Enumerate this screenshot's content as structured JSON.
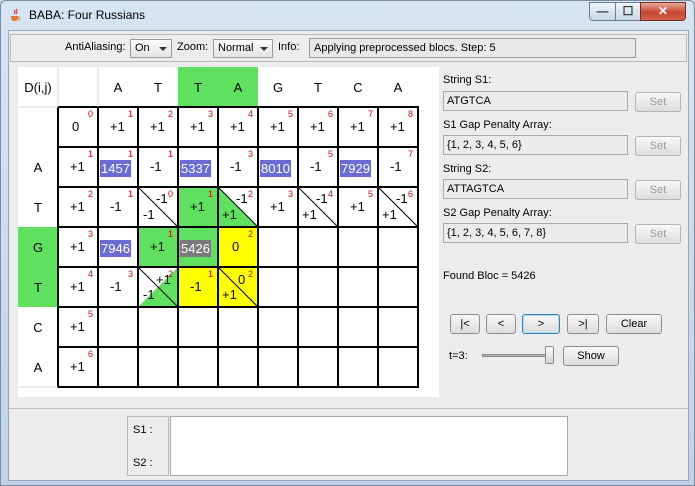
{
  "window": {
    "title": "BABA: Four Russians",
    "min_glyph": "—",
    "max_glyph": "☐",
    "close_glyph": "✕"
  },
  "toolbar": {
    "antialiasing_label": "AntiAliasing:",
    "antialiasing_value": "On",
    "zoom_label": "Zoom:",
    "zoom_value": "Normal",
    "info_label": "Info:",
    "info_text": "Applying preprocessed blocs. Step: 5"
  },
  "grid": {
    "corner_label": "D(i,j)",
    "col_headers": [
      "A",
      "T",
      "T",
      "A",
      "G",
      "T",
      "C",
      "A"
    ],
    "row_headers": [
      "A",
      "T",
      "G",
      "T",
      "C",
      "A"
    ],
    "row0_values": [
      "0",
      "+1",
      "+1",
      "+1",
      "+1",
      "+1",
      "+1",
      "+1",
      "+1"
    ],
    "row0_small": [
      "0",
      "1",
      "2",
      "3",
      "4",
      "5",
      "6",
      "7",
      "8"
    ],
    "col0_values": [
      "+1",
      "+1",
      "+1",
      "+1",
      "+1",
      "+1"
    ],
    "col0_small": [
      "1",
      "2",
      "3",
      "4",
      "5",
      "6"
    ],
    "row1": {
      "blocs": [
        "1457",
        "5337",
        "8010",
        "7929"
      ],
      "values": [
        "-1",
        "-1",
        "-1",
        "-1"
      ],
      "small": [
        "1",
        "1",
        "3",
        "5",
        "7"
      ]
    },
    "row2": {
      "values": [
        "-1",
        "-1",
        "+1",
        "-1",
        "+1",
        "-1",
        "+1",
        "-1"
      ],
      "top_values": [
        "+1",
        "+1",
        "-1",
        "-1",
        "+1",
        "+1",
        "-1",
        "-1"
      ],
      "small": [
        "2",
        "1",
        "0",
        "1",
        "2",
        "3",
        "4",
        "5",
        "6"
      ]
    },
    "row3": {
      "bloc": "7946",
      "plus": "+1",
      "current_bloc": "5426",
      "zero": "0",
      "small": [
        "3",
        "1",
        "2"
      ]
    },
    "row4": {
      "values": [
        "-1",
        "-1",
        "+1",
        "-1",
        "+1",
        "0"
      ],
      "small": [
        "4",
        "3",
        "2",
        "1",
        "2"
      ]
    }
  },
  "right": {
    "s1_label": "String S1:",
    "s1_value": "ATGTCA",
    "set_label": "Set",
    "s1_gap_label": "S1 Gap Penalty Array:",
    "s1_gap_value": "{1, 2, 3, 4, 5, 6}",
    "s2_label": "String S2:",
    "s2_value": "ATTAGTCA",
    "s2_gap_label": "S2 Gap Penalty Array:",
    "s2_gap_value": "{1, 2, 3, 4, 5, 6, 7, 8}",
    "found_bloc": "Found Bloc = 5426",
    "nav_first": "|<",
    "nav_prev": "<",
    "nav_next": ">",
    "nav_last": ">|",
    "clear_label": "Clear",
    "t_label": "t=3:",
    "t_value": 3,
    "t_max": 3,
    "show_label": "Show"
  },
  "bottom": {
    "s1_label": "S1 :",
    "s2_label": "S2 :"
  },
  "colors": {
    "highlight_green": "#5fe05f",
    "highlight_yellow": "#ffff00",
    "bloc_blue": "#6b6bd6",
    "current_bloc_gray": "#7a7a7a",
    "small_red": "#dd0000"
  }
}
